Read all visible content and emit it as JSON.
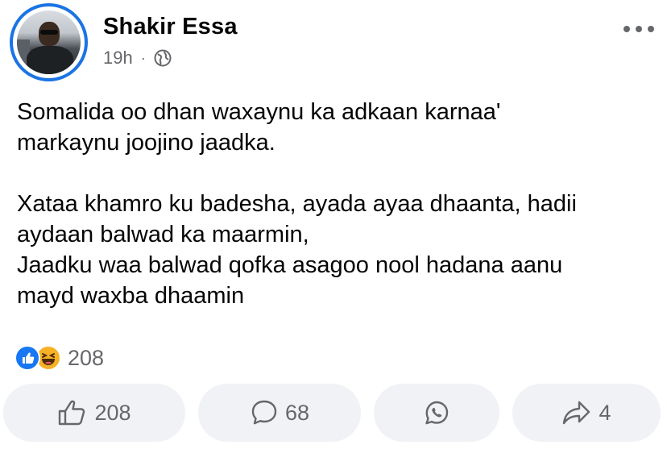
{
  "post": {
    "author": "Shakir Essa",
    "time": "19h",
    "separator": "·",
    "audience_icon": "globe-icon",
    "text": {
      "paragraph1_line1": "Somalida oo dhan waxaynu ka adkaan karnaa'",
      "paragraph1_line2": "markaynu joojino jaadka.",
      "paragraph2_line1": "Xataa khamro ku badesha, ayada ayaa dhaanta, hadii",
      "paragraph2_line2": "aydaan balwad ka maarmin,",
      "paragraph2_line3": "Jaadku waa balwad qofka asagoo nool hadana aanu",
      "paragraph2_line4": "mayd waxba dhaamin"
    }
  },
  "reactions": {
    "icons": [
      "like-reaction-icon",
      "haha-reaction-icon"
    ],
    "count": "208"
  },
  "actions": {
    "like_count": "208",
    "comment_count": "68",
    "share_count": "4"
  },
  "colors": {
    "accent": "#1b74e4",
    "text": "#050505",
    "secondary_text": "#65676b",
    "button_bg": "#f0f2f5",
    "like_blue": "#1877f2",
    "haha_yellow": "#f7b125"
  }
}
